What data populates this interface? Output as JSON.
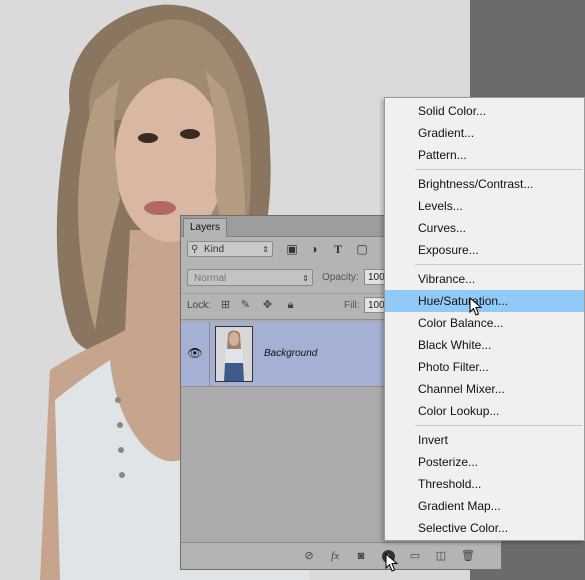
{
  "layers_panel": {
    "tab_label": "Layers",
    "filter_kind": "Kind",
    "blend_mode": "Normal",
    "opacity_label": "Opacity:",
    "opacity_value": "100",
    "lock_label": "Lock:",
    "fill_label": "Fill:",
    "fill_value": "100",
    "layers": [
      {
        "name": "Background",
        "visible": true,
        "selected": true
      }
    ]
  },
  "adjustment_menu": {
    "items": [
      "Solid Color...",
      "Gradient...",
      "Pattern...",
      "Brightness/Contrast...",
      "Levels...",
      "Curves...",
      "Exposure...",
      "Vibrance...",
      "Hue/Saturation...",
      "Color Balance...",
      "Black  White...",
      "Photo Filter...",
      "Channel Mixer...",
      "Color Lookup...",
      "Invert",
      "Posterize...",
      "Threshold...",
      "Gradient Map...",
      "Selective Color..."
    ],
    "highlighted": "Hue/Saturation...",
    "highlight_color": "#91c9f7"
  },
  "colors": {
    "selected_layer": "#a4b0d4",
    "panel_bg": "#b4b4b4",
    "menu_bg": "#f0f0f0"
  }
}
